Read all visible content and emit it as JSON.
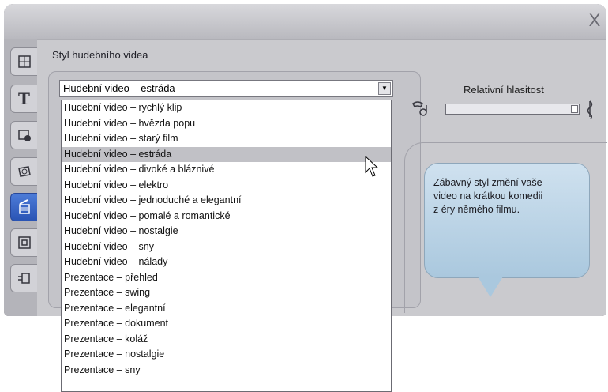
{
  "window": {
    "close_glyph": "X"
  },
  "tools": [
    {
      "icon": "audio-tool-icon"
    },
    {
      "icon": "title-tool-icon",
      "glyph": "T"
    },
    {
      "icon": "menu-tool-icon"
    },
    {
      "icon": "photo-tool-icon"
    },
    {
      "icon": "smartmovie-tool-icon",
      "active": true
    },
    {
      "icon": "overlay-tool-icon"
    },
    {
      "icon": "effects-tool-icon"
    }
  ],
  "panel": {
    "title": "Styl hudebního videa",
    "style_select": {
      "value": "Hudební video – estráda",
      "options": [
        "Hudební video – rychlý klip",
        "Hudební video – hvězda popu",
        "Hudební video – starý film",
        "Hudební video – estráda",
        "Hudební video – divoké a bláznivé",
        "Hudební video – elektro",
        "Hudební video – jednoduché a elegantní",
        "Hudební video – pomalé a romantické",
        "Hudební video – nostalgie",
        "Hudební video – sny",
        "Hudební video – nálady",
        "Prezentace – přehled",
        "Prezentace – swing",
        "Prezentace – elegantní",
        "Prezentace – dokument",
        "Prezentace – koláž",
        "Prezentace – nostalgie",
        "Prezentace – sny"
      ],
      "selected_index": 3
    },
    "volume": {
      "label": "Relativní hlasitost",
      "level": 1.0
    },
    "tooltip": {
      "line1": "Zábavný styl změní vaše",
      "line2": "video na krátkou komedii",
      "line3": "z éry němého filmu."
    }
  },
  "colors": {
    "accent": "#2f5fc8",
    "bubble": "#bcd5e8",
    "panel": "#cacace"
  }
}
